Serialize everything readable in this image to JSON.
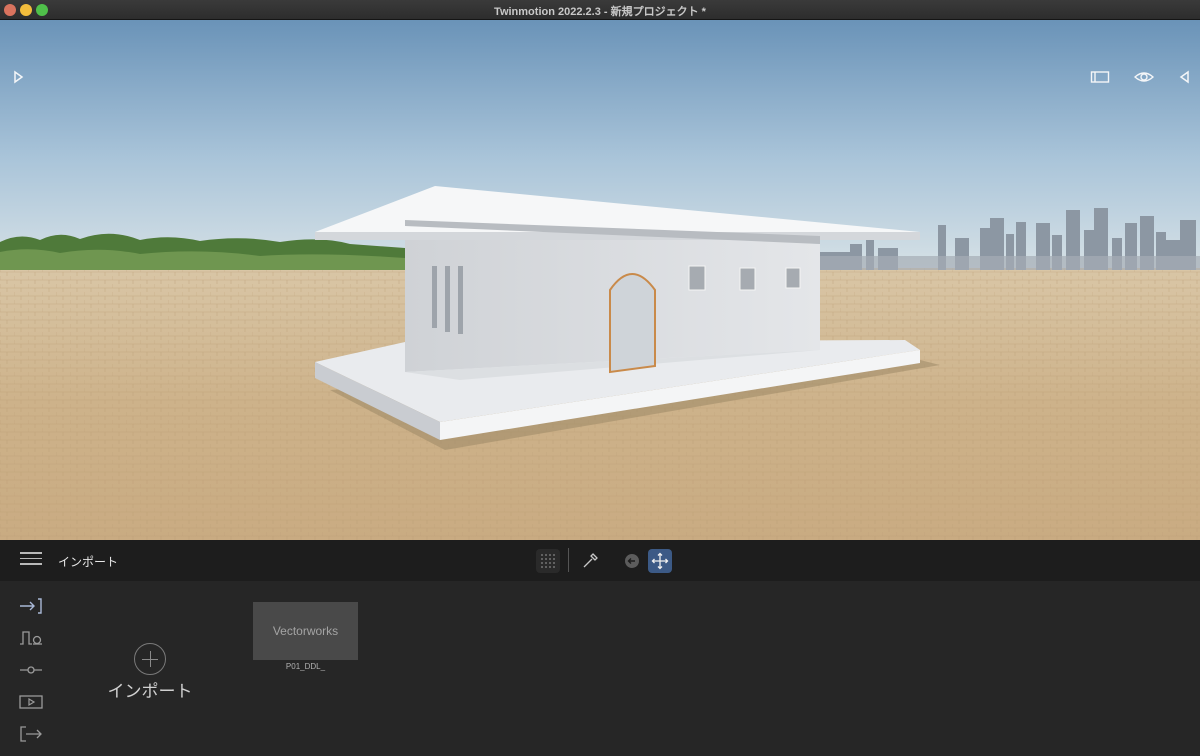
{
  "window": {
    "title": "Twinmotion 2022.2.3 - 新規プロジェクト *"
  },
  "viewport": {
    "left_toggle_icon": "play-right-icon",
    "right_icons": [
      "panel-icon",
      "eye-icon",
      "triangle-left-icon"
    ]
  },
  "toolbar": {
    "section_title": "インポート",
    "tools": [
      "grid-snap-icon",
      "eyedropper-icon",
      "back-icon",
      "move-icon"
    ],
    "accent_color": "#3c5a86"
  },
  "sidebar": {
    "icons": [
      "import-icon",
      "context-icon",
      "configuration-icon",
      "media-icon",
      "export-icon"
    ]
  },
  "import_panel": {
    "import_label": "インポート",
    "assets": [
      {
        "thumbnail_label": "Vectorworks",
        "name": "P01_DDL_"
      }
    ]
  }
}
